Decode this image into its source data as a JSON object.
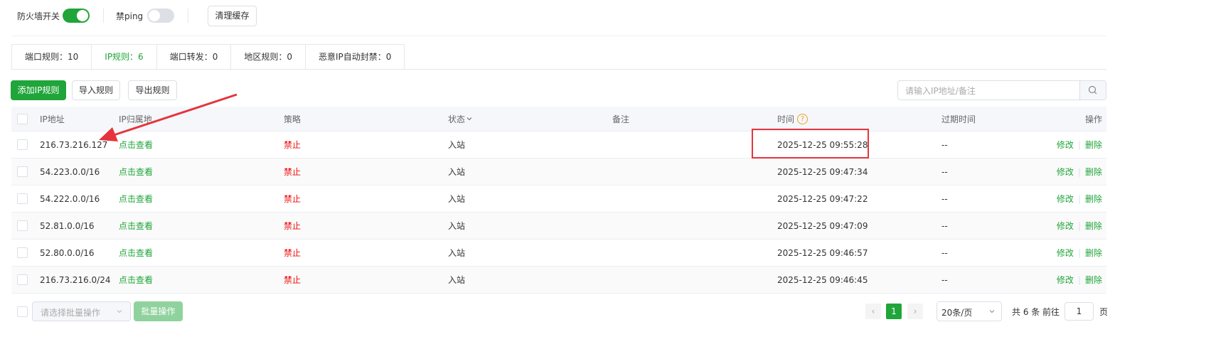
{
  "topbar": {
    "firewall_label": "防火墙开关",
    "firewall_on": true,
    "ping_label": "禁ping",
    "ping_on": false,
    "clear_cache": "清理缓存"
  },
  "tabs": [
    {
      "label": "端口规则：10",
      "active": false
    },
    {
      "label": "IP规则：6",
      "active": true
    },
    {
      "label": "端口转发：0",
      "active": false
    },
    {
      "label": "地区规则：0",
      "active": false
    },
    {
      "label": "恶意IP自动封禁：0",
      "active": false
    }
  ],
  "toolbar": {
    "add": "添加IP规则",
    "import": "导入规则",
    "export": "导出规则",
    "search_placeholder": "请输入IP地址/备注"
  },
  "table": {
    "headers": {
      "ip": "IP地址",
      "location": "IP归属地",
      "policy": "策略",
      "status": "状态",
      "remark": "备注",
      "time": "时间",
      "expire": "过期时间",
      "ops": "操作"
    },
    "rows": [
      {
        "ip": "216.73.216.127",
        "location": "点击查看",
        "policy": "禁止",
        "status": "入站",
        "remark": "",
        "time": "2025-12-25 09:55:28",
        "expire": "--",
        "edit": "修改",
        "delete": "删除"
      },
      {
        "ip": "54.223.0.0/16",
        "location": "点击查看",
        "policy": "禁止",
        "status": "入站",
        "remark": "",
        "time": "2025-12-25 09:47:34",
        "expire": "--",
        "edit": "修改",
        "delete": "删除"
      },
      {
        "ip": "54.222.0.0/16",
        "location": "点击查看",
        "policy": "禁止",
        "status": "入站",
        "remark": "",
        "time": "2025-12-25 09:47:22",
        "expire": "--",
        "edit": "修改",
        "delete": "删除"
      },
      {
        "ip": "52.81.0.0/16",
        "location": "点击查看",
        "policy": "禁止",
        "status": "入站",
        "remark": "",
        "time": "2025-12-25 09:47:09",
        "expire": "--",
        "edit": "修改",
        "delete": "删除"
      },
      {
        "ip": "52.80.0.0/16",
        "location": "点击查看",
        "policy": "禁止",
        "status": "入站",
        "remark": "",
        "time": "2025-12-25 09:46:57",
        "expire": "--",
        "edit": "修改",
        "delete": "删除"
      },
      {
        "ip": "216.73.216.0/24",
        "location": "点击查看",
        "policy": "禁止",
        "status": "入站",
        "remark": "",
        "time": "2025-12-25 09:46:45",
        "expire": "--",
        "edit": "修改",
        "delete": "删除"
      }
    ]
  },
  "footer": {
    "batch_placeholder": "请选择批量操作",
    "batch_button": "批量操作",
    "current_page": "1",
    "page_size": "20条/页",
    "total": "共 6 条",
    "goto_label": "前往",
    "goto_value": "1",
    "page_unit": "页"
  },
  "colors": {
    "accent": "#20a53a",
    "danger": "#ef0808",
    "highlight": "#e5343d"
  }
}
